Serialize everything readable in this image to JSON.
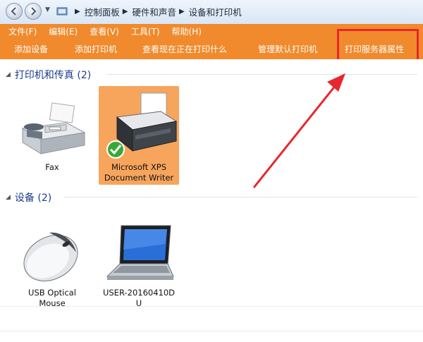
{
  "breadcrumb": [
    "控制面板",
    "硬件和声音",
    "设备和打印机"
  ],
  "menu": [
    "文件(F)",
    "编辑(E)",
    "查看(V)",
    "工具(T)",
    "帮助(H)"
  ],
  "toolbar": {
    "add_device": "添加设备",
    "add_printer": "添加打印机",
    "see_printing": "查看现在正在打印什么",
    "manage_default": "管理默认打印机",
    "print_server_props": "打印服务器属性"
  },
  "groups": {
    "printers": {
      "header": "打印机和传真 (2)",
      "items": [
        {
          "label_line1": "Fax",
          "label_line2": ""
        },
        {
          "label_line1": "Microsoft XPS",
          "label_line2": "Document Writer"
        }
      ]
    },
    "devices": {
      "header": "设备 (2)",
      "items": [
        {
          "label_line1": "USB Optical",
          "label_line2": "Mouse"
        },
        {
          "label_line1": "USER-20160410D",
          "label_line2": "U"
        }
      ]
    }
  },
  "colors": {
    "toolbar_orange": "#f08a2c",
    "selected_item": "#f7a55d",
    "highlight_red": "#e8262d",
    "group_header": "#1e3c8c"
  }
}
